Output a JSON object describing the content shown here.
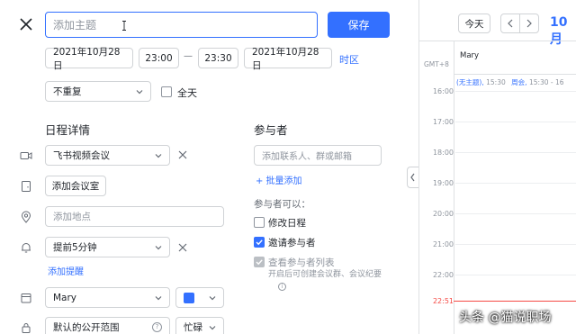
{
  "editor": {
    "title_placeholder": "添加主题",
    "save_label": "保存",
    "start_date": "2021年10月28日",
    "start_time": "23:00",
    "dash": "—",
    "end_time": "23:30",
    "end_date": "2021年10月28日",
    "timezone_label": "时区",
    "repeat_value": "不重复",
    "allday_label": "全天"
  },
  "details": {
    "heading": "日程详情",
    "video_meeting": "飞书视频会议",
    "add_room": "添加会议室",
    "location_placeholder": "添加地点",
    "reminder": "提前5分钟",
    "add_reminder": "添加提醒",
    "calendar": "Mary",
    "calendar_color": "#3370ff",
    "visibility": "默认的公开范围",
    "busy": "忙碌"
  },
  "participants": {
    "heading": "参与者",
    "input_placeholder": "添加联系人、群或邮箱",
    "bulk_add": "+ 批量添加",
    "can_label": "参与者可以：",
    "perm_edit": "修改日程",
    "perm_invite": "邀请参与者",
    "perm_view": "查看参与者列表",
    "perm_note": "开启后可创建会议群、会议纪要"
  },
  "calendar": {
    "today_btn": "今天",
    "month_label": "10月",
    "timezone": "GMT+8",
    "owner": "Mary",
    "event_untitled": "(无主题),",
    "event_untitled_time": "15:30",
    "event_weekly": "周会,",
    "event_weekly_time": "15:30 - 16",
    "hours": [
      "16:00",
      "17:00",
      "18:00",
      "19:00",
      "20:00",
      "21:00",
      "22:00"
    ],
    "now_time": "22:51",
    "accent": "#3370ff",
    "now_color": "#f54a45"
  },
  "watermark": "头条 @猫说职场"
}
